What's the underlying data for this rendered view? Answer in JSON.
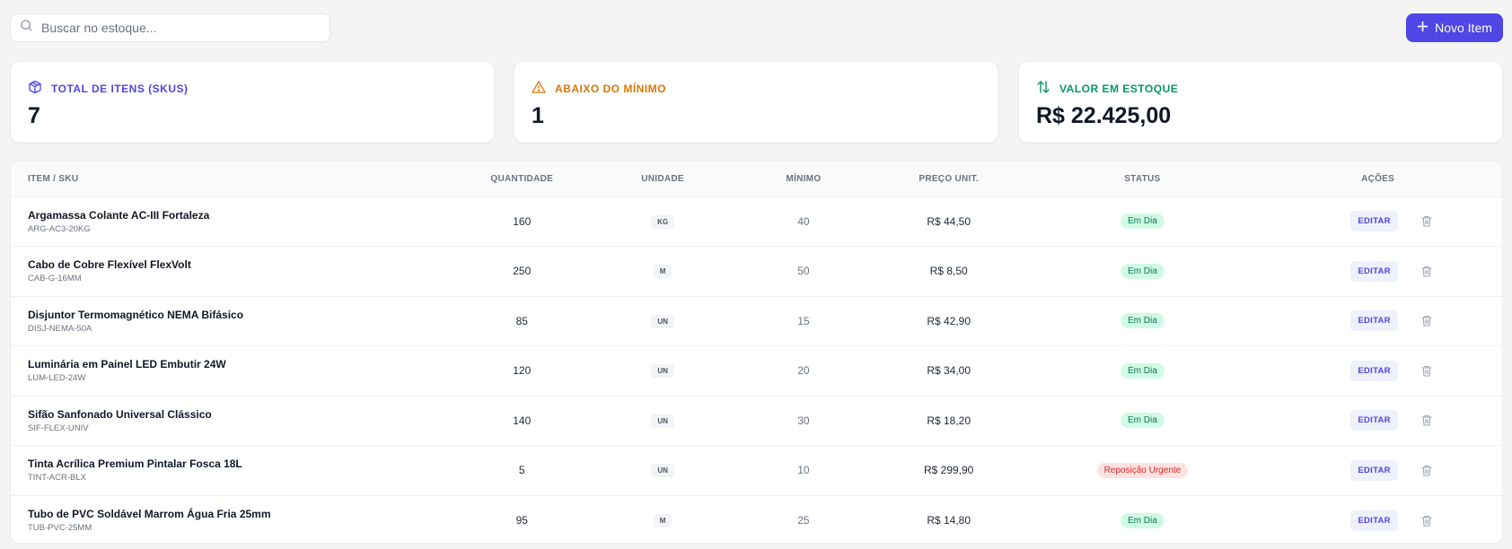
{
  "search": {
    "placeholder": "Buscar no estoque..."
  },
  "new_item_button": {
    "label": "Novo Item"
  },
  "stats": [
    {
      "label": "TOTAL DE ITENS (SKUS)",
      "value": "7",
      "icon": "box-icon",
      "color": "#4f46e5"
    },
    {
      "label": "ABAIXO DO MÍNIMO",
      "value": "1",
      "icon": "warning-icon",
      "color": "#d97706"
    },
    {
      "label": "VALOR EM ESTOQUE",
      "value": "R$ 22.425,00",
      "icon": "arrows-up-down-icon",
      "color": "#059669"
    }
  ],
  "table": {
    "headers": [
      "ITEM / SKU",
      "QUANTIDADE",
      "UNIDADE",
      "MÍNIMO",
      "PREÇO UNIT.",
      "STATUS",
      "AÇÕES"
    ],
    "edit_label": "EDITAR",
    "rows": [
      {
        "name": "Argamassa Colante AC-III Fortaleza",
        "sku": "ARG-AC3-20KG",
        "qty": "160",
        "unit": "KG",
        "min": "40",
        "price": "R$ 44,50",
        "status": "Em Dia",
        "status_type": "ok"
      },
      {
        "name": "Cabo de Cobre Flexível FlexVolt",
        "sku": "CAB-G-16MM",
        "qty": "250",
        "unit": "M",
        "min": "50",
        "price": "R$ 8,50",
        "status": "Em Dia",
        "status_type": "ok"
      },
      {
        "name": "Disjuntor Termomagnético NEMA Bifásico",
        "sku": "DISJ-NEMA-50A",
        "qty": "85",
        "unit": "UN",
        "min": "15",
        "price": "R$ 42,90",
        "status": "Em Dia",
        "status_type": "ok"
      },
      {
        "name": "Luminária em Painel LED Embutir 24W",
        "sku": "LUM-LED-24W",
        "qty": "120",
        "unit": "UN",
        "min": "20",
        "price": "R$ 34,00",
        "status": "Em Dia",
        "status_type": "ok"
      },
      {
        "name": "Sifão Sanfonado Universal Clássico",
        "sku": "SIF-FLEX-UNIV",
        "qty": "140",
        "unit": "UN",
        "min": "30",
        "price": "R$ 18,20",
        "status": "Em Dia",
        "status_type": "ok"
      },
      {
        "name": "Tinta Acrílica Premium Pintalar Fosca 18L",
        "sku": "TINT-ACR-BLX",
        "qty": "5",
        "unit": "UN",
        "min": "10",
        "price": "R$ 299,90",
        "status": "Reposição Urgente",
        "status_type": "urgent"
      },
      {
        "name": "Tubo de PVC Soldável Marrom Água Fria 25mm",
        "sku": "TUB-PVC-25MM",
        "qty": "95",
        "unit": "M",
        "min": "25",
        "price": "R$ 14,80",
        "status": "Em Dia",
        "status_type": "ok"
      }
    ]
  }
}
